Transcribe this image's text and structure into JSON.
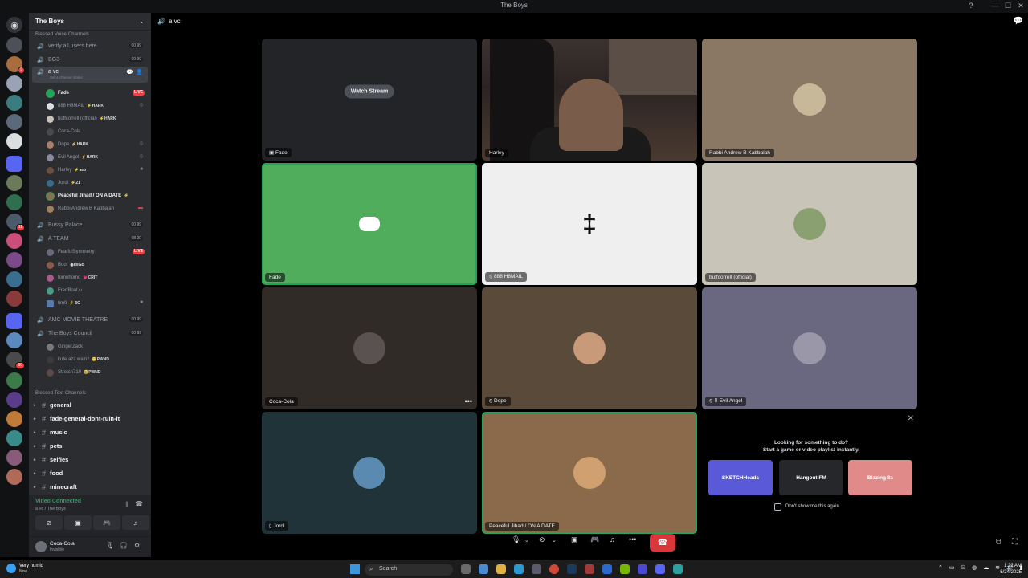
{
  "window": {
    "title": "The Boys",
    "buttons": [
      "?",
      "—",
      "☐",
      "✕"
    ]
  },
  "server": {
    "name": "The Boys"
  },
  "sidebar": {
    "voice_category": "Blessed Voice Channels",
    "voice_channels": [
      {
        "name": "verify all users here",
        "count_a": "00",
        "count_b": "99"
      },
      {
        "name": "BG3",
        "count_a": "00",
        "count_b": "99"
      },
      {
        "name": "a vc",
        "status_placeholder": "Set a channel status"
      }
    ],
    "a_vc_members": [
      {
        "name": "Fade",
        "tag": "",
        "badge": "LIVE"
      },
      {
        "name": "888 H8MAIL",
        "tag": "⚡HARK",
        "badge": ""
      },
      {
        "name": "buffcorrell (official)",
        "tag": "⚡HARK",
        "badge": ""
      },
      {
        "name": "Coca-Cola",
        "tag": "",
        "badge": ""
      },
      {
        "name": "Dope",
        "tag": "⚡HARK",
        "badge": ""
      },
      {
        "name": "Evil Angel",
        "tag": "⚡HARK",
        "badge": ""
      },
      {
        "name": "Harley",
        "tag": "⚡aeo",
        "badge": ""
      },
      {
        "name": "Jordi",
        "tag": "⚡21",
        "badge": ""
      },
      {
        "name": "Peaceful Jihad / ON A DATE",
        "tag": "⚡",
        "badge": ""
      },
      {
        "name": "Rabbi Andrew B Kabbalah",
        "tag": "",
        "badge": ""
      }
    ],
    "bussy_palace": {
      "name": "Bussy Palace",
      "count_a": "00",
      "count_b": "99"
    },
    "a_team": {
      "name": "A TEAM",
      "count_a": "08",
      "count_b": "20"
    },
    "a_team_members": [
      {
        "name": "FearfulSymmetry",
        "tag": "",
        "badge": "LIVE"
      },
      {
        "name": "Boof",
        "tag": "◉dsGB",
        "badge": ""
      },
      {
        "name": "fomohomo",
        "tag": "💗CRIT",
        "badge": ""
      },
      {
        "name": "FredBoat♪♪",
        "tag": "",
        "badge": ""
      },
      {
        "name": "tim0",
        "tag": "⚡BG",
        "badge": ""
      }
    ],
    "amc": {
      "name": "AMC MOVIE THEATRE",
      "count_a": "00",
      "count_b": "99"
    },
    "council": {
      "name": "The Boys Council",
      "count_a": "00",
      "count_b": "99"
    },
    "council_members": [
      {
        "name": "GingerZack",
        "tag": ""
      },
      {
        "name": "kute azz wainz",
        "tag": "😊PWND"
      },
      {
        "name": "Stretch710",
        "tag": "😊PWND"
      }
    ],
    "text_category": "Blessed Text Channels",
    "text_channels": [
      "general",
      "fade-general-dont-ruin-it",
      "music",
      "pets",
      "selfies",
      "food",
      "minecraft"
    ]
  },
  "voice_panel": {
    "status": "Video Connected",
    "location": "a vc / The Boys"
  },
  "user": {
    "name": "Coca-Cola",
    "status": "Invisible"
  },
  "stage": {
    "channel": "a vc",
    "tiles": [
      {
        "name": "Fade",
        "watch_label": "Watch Stream"
      },
      {
        "name": "Harley"
      },
      {
        "name": "Rabbi Andrew B Kabbalah"
      },
      {
        "name": "Fade"
      },
      {
        "name": "888 H8MAIL"
      },
      {
        "name": "buffcorrell (official)"
      },
      {
        "name": "Coca-Cola"
      },
      {
        "name": "Dope"
      },
      {
        "name": "Evil Angel"
      },
      {
        "name": "Jordi"
      },
      {
        "name": "Peaceful Jihad / ON A DATE"
      }
    ]
  },
  "activity": {
    "heading1": "Looking for something to do?",
    "heading2": "Start a game or video playlist instantly.",
    "cards": [
      "SKETCHHeads",
      "Hangout FM",
      "Blazing 8s"
    ],
    "checkbox_label": "Don't show me this again."
  },
  "taskbar": {
    "weather": "Very humid",
    "weather_sub": "Now",
    "search": "Search",
    "time": "1:22 AM",
    "date": "6/24/2025"
  },
  "colors": {
    "green": "#23a559",
    "red": "#da373c",
    "blurple": "#5865f2",
    "fade_tile": "#4fad5b"
  }
}
